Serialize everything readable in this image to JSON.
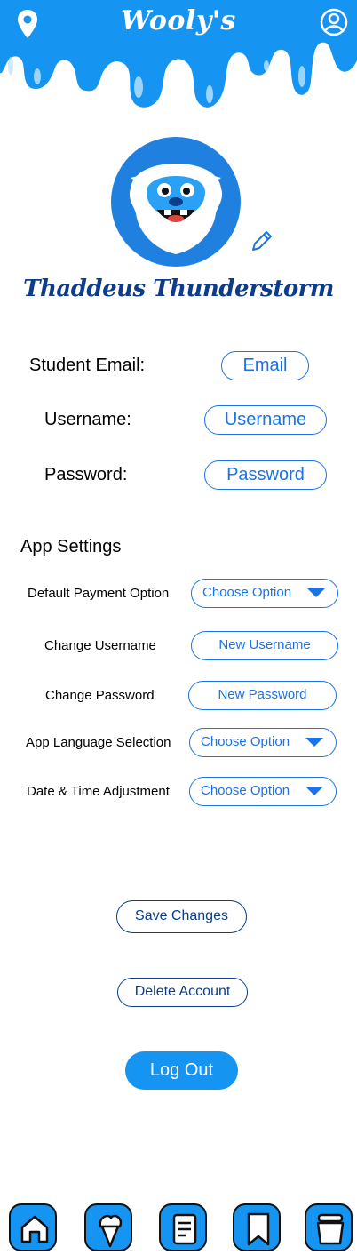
{
  "header": {
    "title": "Wooly's"
  },
  "icons": {
    "location": "map-pin-icon",
    "account": "account-circle-icon",
    "edit": "pencil-icon"
  },
  "profile": {
    "name": "Thaddeus Thunderstorm"
  },
  "credentials": {
    "email": {
      "label": "Student Email:",
      "button": "Email"
    },
    "username": {
      "label": "Username:",
      "button": "Username"
    },
    "password": {
      "label": "Password:",
      "button": "Password"
    }
  },
  "app_settings": {
    "title": "App Settings",
    "payment": {
      "label": "Default Payment Option",
      "value": "Choose Option"
    },
    "change_username": {
      "label": "Change Username",
      "value": "New Username"
    },
    "change_password": {
      "label": "Change Password",
      "value": "New Password"
    },
    "language": {
      "label": "App Language Selection",
      "value": "Choose Option"
    },
    "datetime": {
      "label": "Date & Time Adjustment",
      "value": "Choose Option"
    }
  },
  "actions": {
    "save": "Save Changes",
    "delete": "Delete Account",
    "logout": "Log Out"
  },
  "bottom_nav": [
    "home-icon",
    "ice-cream-icon",
    "menu-list-icon",
    "bookmark-icon",
    "ice-cream-tub-icon"
  ],
  "colors": {
    "brand_blue": "#1594f2",
    "accent_blue": "#1a73e8",
    "navy": "#0d3c8a"
  }
}
